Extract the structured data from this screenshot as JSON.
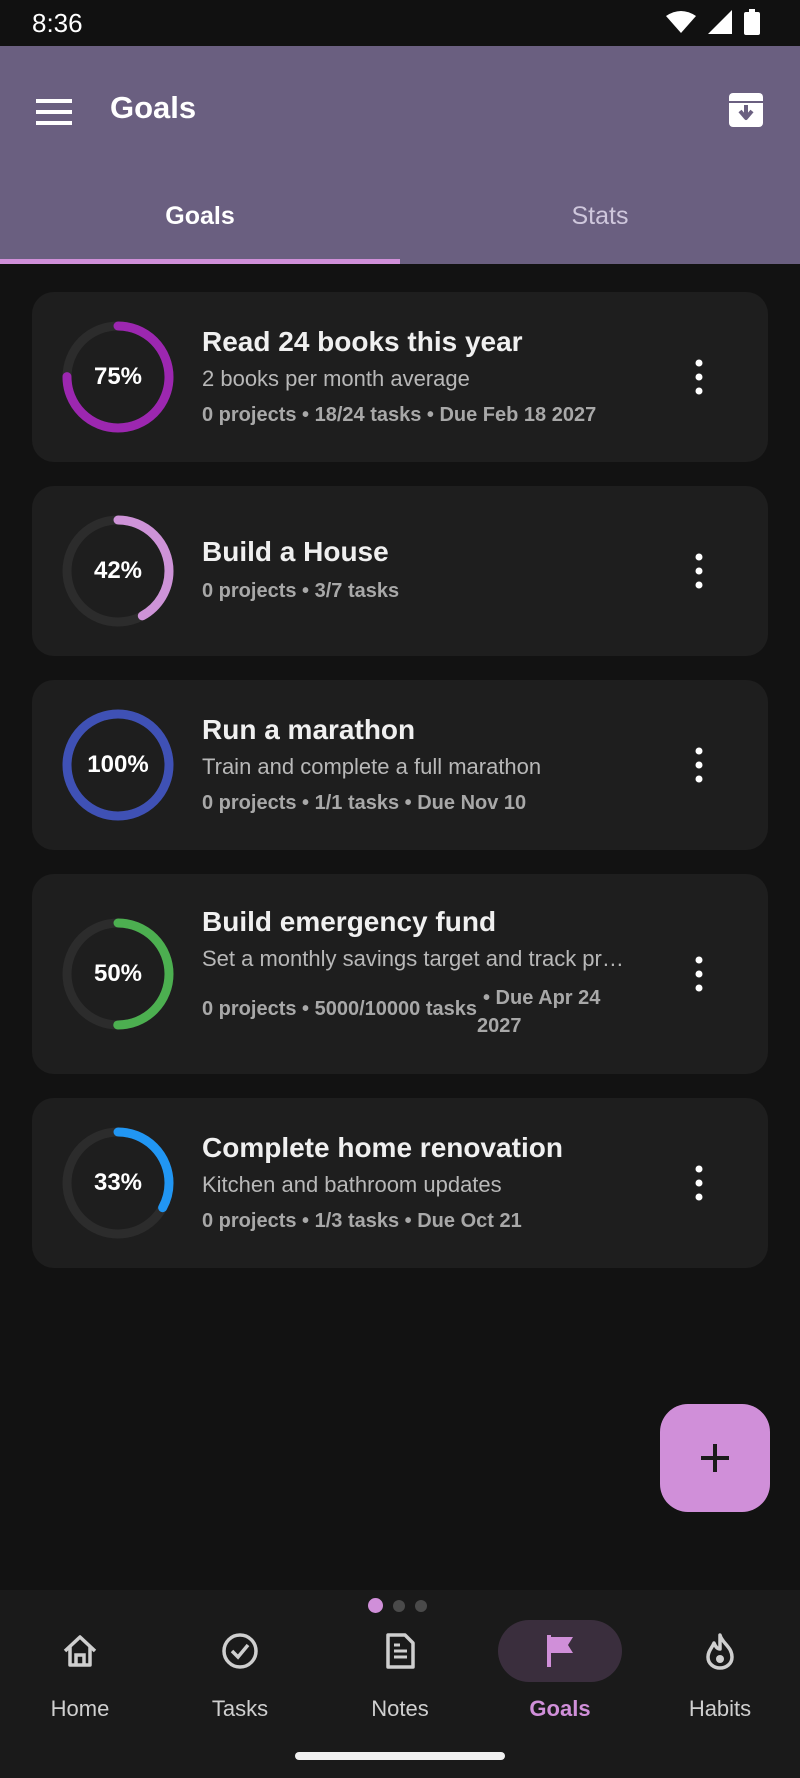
{
  "status_bar": {
    "time": "8:36"
  },
  "app_bar": {
    "title": "Goals"
  },
  "tabs": [
    {
      "label": "Goals",
      "active": true
    },
    {
      "label": "Stats",
      "active": false
    }
  ],
  "goals": [
    {
      "title": "Read 24 books this year",
      "description": "2 books per month average",
      "meta": "0 projects • 18/24 tasks • Due Feb 18 2027",
      "progress_label": "75%",
      "progress": 0.75,
      "color": "#9c27b0"
    },
    {
      "title": "Build a House",
      "description": "",
      "meta": "0 projects • 3/7 tasks",
      "progress_label": "42%",
      "progress": 0.42,
      "color": "#ce93d8"
    },
    {
      "title": "Run a marathon",
      "description": "Train and complete a full marathon",
      "meta": "0 projects • 1/1 tasks • Due Nov 10",
      "progress_label": "100%",
      "progress": 1.0,
      "color": "#3f51b5"
    },
    {
      "title": "Build emergency fund",
      "description": "Set a monthly savings target and track pr…",
      "meta_left": "0 projects • 5000/10000 tasks",
      "meta_right_1": "• Due Apr 24",
      "meta_right_2": "2027",
      "progress_label": "50%",
      "progress": 0.5,
      "color": "#4caf50"
    },
    {
      "title": "Complete home renovation",
      "description": "Kitchen and bathroom updates",
      "meta": "0 projects • 1/3 tasks • Due Oct 21",
      "progress_label": "33%",
      "progress": 0.33,
      "color": "#2196f3"
    }
  ],
  "fab": {
    "icon": "plus-icon"
  },
  "bottom_nav": [
    {
      "label": "Home",
      "icon": "home-icon",
      "active": false
    },
    {
      "label": "Tasks",
      "icon": "check-circle-icon",
      "active": false
    },
    {
      "label": "Notes",
      "icon": "document-icon",
      "active": false
    },
    {
      "label": "Goals",
      "icon": "flag-icon",
      "active": true
    },
    {
      "label": "Habits",
      "icon": "flame-icon",
      "active": false
    }
  ],
  "colors": {
    "accent": "#d08fd9",
    "app_bar": "#6a5f80",
    "card": "#1e1e1e",
    "background": "#121212"
  }
}
